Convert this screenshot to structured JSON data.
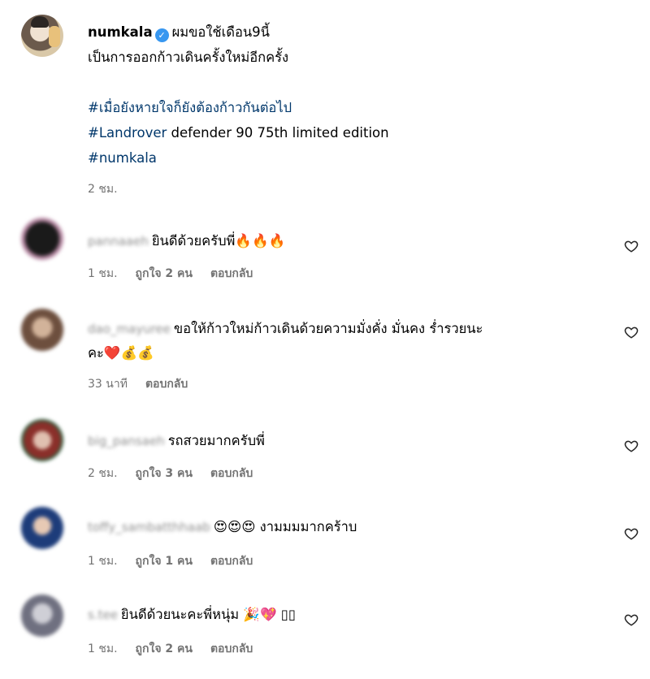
{
  "post": {
    "username": "numkala",
    "caption_line1": "ผมขอใช้เดือน9นี้",
    "caption_line2": "เป็นการออกก้าวเดินครั้งใหม่อีกครั้ง",
    "hashtag1": "#เมื่อยังหายใจก็ยังต้องก้าวกันต่อไป",
    "hashtag2": "#Landrover",
    "hashtag2_rest": " defender 90 75th limited edition",
    "hashtag3": "#numkala",
    "time": "2 ชม."
  },
  "comments": [
    {
      "username": "pannaaeh",
      "text": "ยินดีด้วยครับพี่🔥🔥🔥",
      "time": "1 ชม.",
      "likes": "ถูกใจ 2 คน",
      "reply": "ตอบกลับ"
    },
    {
      "username": "dao_mayuree",
      "text": "ขอให้ก้าวใหม่ก้าวเดินด้วยความมั่งคั่ง มั่นคง ร่ำรวยนะ",
      "text2": "คะ❤️💰💰",
      "time": "33 นาที",
      "likes": "",
      "reply": "ตอบกลับ"
    },
    {
      "username": "big_pansaeh",
      "text": "รถสวยมากครับพี่",
      "time": "2 ชม.",
      "likes": "ถูกใจ 3 คน",
      "reply": "ตอบกลับ"
    },
    {
      "username": "toffy_sambatthhaab",
      "text": "😍😍😍 งามมมมากคร้าบ",
      "time": "1 ชม.",
      "likes": "ถูกใจ 1 คน",
      "reply": "ตอบกลับ"
    },
    {
      "username": "s.tee",
      "text": "ยินดีด้วยนะคะพี่หนุ่ม 🎉💖 ▯▯",
      "time": "1 ชม.",
      "likes": "ถูกใจ 2 คน",
      "reply": "ตอบกลับ"
    }
  ]
}
